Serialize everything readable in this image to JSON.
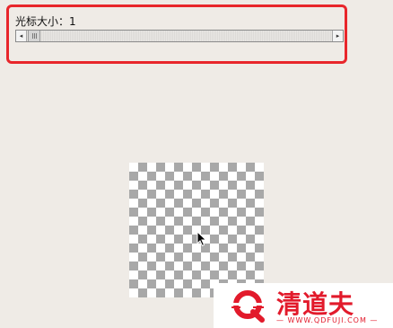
{
  "cursor_size": {
    "label": "光标大小：1",
    "value": 1
  },
  "scrollbar": {
    "left_arrow": "◂",
    "right_arrow": "▸"
  },
  "watermark": {
    "title": "清道夫",
    "url": "— WWW.QDFUJI.COM —"
  },
  "colors": {
    "highlight": "#e8262b",
    "brand": "#e21a2b"
  }
}
